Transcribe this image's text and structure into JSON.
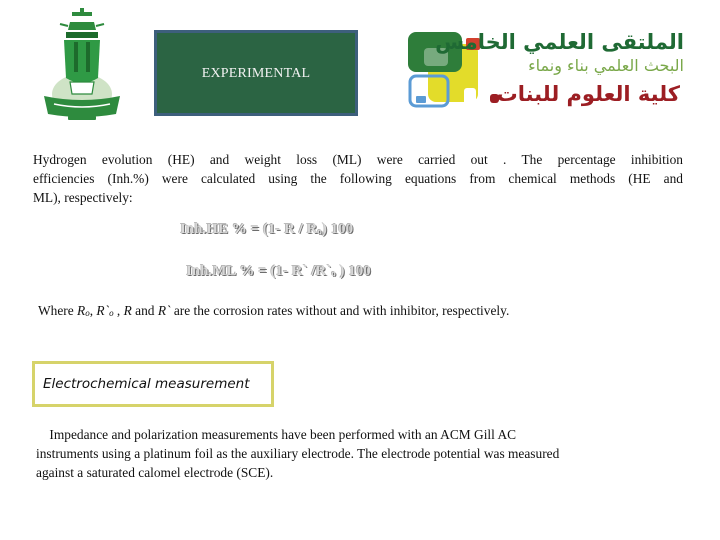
{
  "header": {
    "title": "EXPERIMENTAL",
    "university_logo": "king-abdulaziz-university-logo",
    "forum_logo": {
      "title_ar": "الملتقى العلمي الخامس",
      "subtitle_ar": "البحث العلمي بناء ونماء",
      "college_ar": "كلية العلوم للبنات",
      "colors": {
        "dark_green": "#2e7d3a",
        "yellow": "#e3dc2a",
        "red": "#d2412e",
        "blue": "#5b9bd5",
        "title_green": "#1f6a34",
        "college_red": "#9c1e23"
      }
    },
    "title_box_colors": {
      "fill": "#2b6443",
      "border": "#3d5f7c"
    }
  },
  "intro": {
    "lines": [
      "Hydrogen evolution (HE) and weight loss (ML) were carried out . The percentage inhibition",
      "efficiencies (Inh.%) were calculated using the following equations from chemical methods (HE and",
      "ML), respectively:"
    ]
  },
  "equations": {
    "he": {
      "lhs": "Inh.HE % = (1- R / R",
      "sub": "o",
      "rhs": ") 100"
    },
    "ml": {
      "lhs": "Inh.ML % = (1- R` /R`",
      "sub": "o",
      "rhs": " ) 100"
    }
  },
  "where": {
    "prefix": "Where ",
    "r0": "R",
    "r0_sub": "o",
    "sep1": ", ",
    "rp0": "R`",
    "rp0_sub": "o",
    "sep2": " , ",
    "r": "R",
    "and": " and ",
    "rp": "R`",
    "suffix": " are the corrosion rates without and with inhibitor,   respectively."
  },
  "section": {
    "label": "Electrochemical measurement",
    "border_color": "#d6d36a"
  },
  "method": {
    "lines": [
      "    Impedance and polarization measurements have been performed with an ACM Gill AC",
      "instruments using a platinum foil as the auxiliary electrode. The electrode potential was measured",
      "against a saturated calomel electrode (SCE)."
    ]
  }
}
